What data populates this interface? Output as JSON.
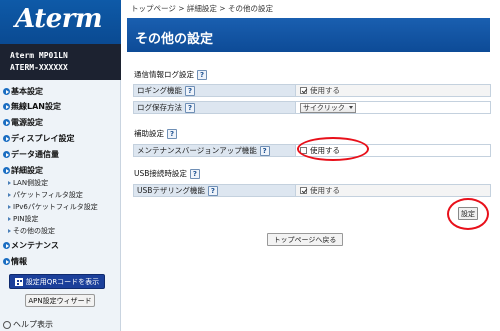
{
  "brand": {
    "logo": "Aterm",
    "model_line1": "Aterm   MP01LN",
    "model_line2": "ATERM-XXXXXX"
  },
  "nav": {
    "items": [
      {
        "label": "基本設定"
      },
      {
        "label": "無線LAN設定"
      },
      {
        "label": "電源設定"
      },
      {
        "label": "ディスプレイ設定"
      },
      {
        "label": "データ通信量"
      },
      {
        "label": "詳細設定"
      }
    ],
    "sub_items": [
      {
        "label": "LAN側設定"
      },
      {
        "label": "パケットフィルタ設定"
      },
      {
        "label": "IPv6パケットフィルタ設定"
      },
      {
        "label": "PIN設定"
      },
      {
        "label": "その他の設定"
      }
    ],
    "bottom_items": [
      {
        "label": "メンテナンス"
      },
      {
        "label": "情報"
      }
    ],
    "qr_button": "設定用QRコードを表示",
    "apn_button": "APN設定ウィザード",
    "help": "ヘルプ表示"
  },
  "breadcrumb": {
    "top": "トップページ",
    "sep1": " > ",
    "detail": "詳細設定",
    "sep2": " > ",
    "current": "その他の設定"
  },
  "page_title": "その他の設定",
  "help_badge": "?",
  "sections": {
    "comm_log": {
      "title": "通信情報ログ設定",
      "logging_label": "ロギング機能",
      "logging_value": "使用する",
      "logging_checked": true,
      "method_label": "ログ保存方法",
      "method_value": "サイクリック"
    },
    "assist": {
      "title": "補助設定",
      "maint_label": "メンテナンスバージョンアップ機能",
      "maint_value": "使用する",
      "maint_checked": false
    },
    "usb": {
      "title": "USB接続時設定",
      "tether_label": "USBテザリング機能",
      "tether_value": "使用する",
      "tether_checked": true
    }
  },
  "buttons": {
    "set": "設定",
    "back_top": "トップページへ戻る"
  },
  "colors": {
    "title_bar": "#0d4b97",
    "highlight": "#e8101a",
    "label_bg": "#dde6f0",
    "sidebar_logo": "#0e5aa8"
  }
}
